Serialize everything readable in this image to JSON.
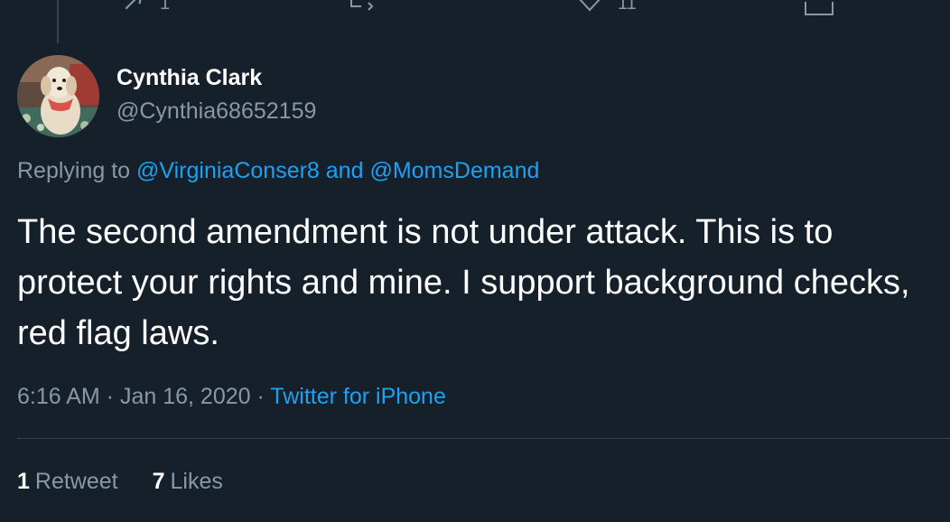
{
  "colors": {
    "background": "#15202b",
    "primary_text": "#ffffff",
    "secondary_text": "#8899a6",
    "accent": "#1da1f2",
    "border": "#38444d"
  },
  "previous_tweet_actions": [
    {
      "icon": "reply-icon",
      "count": "1"
    },
    {
      "icon": "retweet-icon",
      "count": ""
    },
    {
      "icon": "like-icon",
      "count": "11"
    },
    {
      "icon": "share-icon",
      "count": ""
    }
  ],
  "tweet": {
    "author": {
      "display_name": "Cynthia Clark",
      "handle": "@Cynthia68652159",
      "avatar_icon": "dog-avatar"
    },
    "replying_to": {
      "prefix": "Replying to",
      "mention_1": "@VirginiaConser8",
      "conjunction": "and",
      "mention_2": "@MomsDemand"
    },
    "text": "The second amendment is not under attack. This is to protect your rights and mine. I support background checks, red flag laws.",
    "time": "6:16 AM",
    "date": "Jan 16, 2020",
    "separator": "·",
    "source": "Twitter for iPhone"
  },
  "stats": {
    "retweets_count": "1",
    "retweets_label": "Retweet",
    "likes_count": "7",
    "likes_label": "Likes"
  }
}
